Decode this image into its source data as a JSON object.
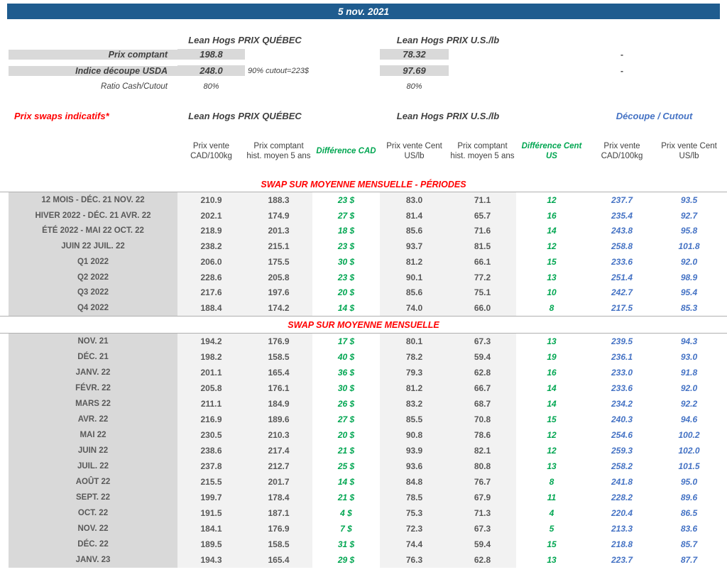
{
  "colors": {
    "bar_blue": "#1F5C8F",
    "red": "#FF0000",
    "green": "#00A651",
    "cutout_blue": "#4472C4",
    "label_bg": "#D9D9D9",
    "value_bg": "#F2F2F2"
  },
  "date_bar": {
    "date": "5 nov. 2021"
  },
  "top": {
    "quebec_header": "Lean Hogs PRIX QUÉBEC",
    "us_header": "Lean Hogs PRIX U.S./lb",
    "rows": [
      {
        "label": "Prix comptant",
        "qc": "198.8",
        "note": "",
        "us": "78.32",
        "cutout": "-"
      },
      {
        "label": "Indice découpe USDA",
        "qc": "248.0",
        "note": "90% cutout=223$",
        "us": "97.69",
        "cutout": "-"
      },
      {
        "label": "Ratio Cash/Cutout",
        "qc": "80%",
        "note": "",
        "us": "80%",
        "cutout": ""
      }
    ]
  },
  "swaps_header": {
    "title": "Prix swaps indicatifs*",
    "quebec_header": "Lean Hogs PRIX QUÉBEC",
    "us_header": "Lean Hogs PRIX U.S./lb",
    "cutout_header": "Découpe / Cutout",
    "columns": [
      "Prix vente CAD/100kg",
      "Prix comptant hist. moyen 5 ans",
      "Différence CAD",
      "Prix vente Cent US/lb",
      "Prix comptant hist. moyen 5 ans",
      "Différence Cent US",
      "Prix vente CAD/100kg",
      "Prix vente Cent US/lb"
    ]
  },
  "sections": [
    {
      "title": "SWAP SUR MOYENNE MENSUELLE - PÉRIODES",
      "rows": [
        [
          "12 MOIS - DÉC. 21 NOV. 22",
          "210.9",
          "188.3",
          "23 $",
          "83.0",
          "71.1",
          "12",
          "237.7",
          "93.5"
        ],
        [
          "HIVER 2022 - DÉC. 21 AVR. 22",
          "202.1",
          "174.9",
          "27 $",
          "81.4",
          "65.7",
          "16",
          "235.4",
          "92.7"
        ],
        [
          "ÉTÉ 2022 - MAI 22 OCT. 22",
          "218.9",
          "201.3",
          "18 $",
          "85.6",
          "71.6",
          "14",
          "243.8",
          "95.8"
        ],
        [
          "JUIN 22 JUIL. 22",
          "238.2",
          "215.1",
          "23 $",
          "93.7",
          "81.5",
          "12",
          "258.8",
          "101.8"
        ],
        [
          "Q1 2022",
          "206.0",
          "175.5",
          "30 $",
          "81.2",
          "66.1",
          "15",
          "233.6",
          "92.0"
        ],
        [
          "Q2 2022",
          "228.6",
          "205.8",
          "23 $",
          "90.1",
          "77.2",
          "13",
          "251.4",
          "98.9"
        ],
        [
          "Q3 2022",
          "217.6",
          "197.6",
          "20 $",
          "85.6",
          "75.1",
          "10",
          "242.7",
          "95.4"
        ],
        [
          "Q4 2022",
          "188.4",
          "174.2",
          "14 $",
          "74.0",
          "66.0",
          "8",
          "217.5",
          "85.3"
        ]
      ]
    },
    {
      "title": "SWAP SUR MOYENNE MENSUELLE",
      "rows": [
        [
          "NOV. 21",
          "194.2",
          "176.9",
          "17 $",
          "80.1",
          "67.3",
          "13",
          "239.5",
          "94.3"
        ],
        [
          "DÉC. 21",
          "198.2",
          "158.5",
          "40 $",
          "78.2",
          "59.4",
          "19",
          "236.1",
          "93.0"
        ],
        [
          "JANV. 22",
          "201.1",
          "165.4",
          "36 $",
          "79.3",
          "62.8",
          "16",
          "233.0",
          "91.8"
        ],
        [
          "FÉVR. 22",
          "205.8",
          "176.1",
          "30 $",
          "81.2",
          "66.7",
          "14",
          "233.6",
          "92.0"
        ],
        [
          "MARS 22",
          "211.1",
          "184.9",
          "26 $",
          "83.2",
          "68.7",
          "14",
          "234.2",
          "92.2"
        ],
        [
          "AVR. 22",
          "216.9",
          "189.6",
          "27 $",
          "85.5",
          "70.8",
          "15",
          "240.3",
          "94.6"
        ],
        [
          "MAI 22",
          "230.5",
          "210.3",
          "20 $",
          "90.8",
          "78.6",
          "12",
          "254.6",
          "100.2"
        ],
        [
          "JUIN 22",
          "238.6",
          "217.4",
          "21 $",
          "93.9",
          "82.1",
          "12",
          "259.3",
          "102.0"
        ],
        [
          "JUIL. 22",
          "237.8",
          "212.7",
          "25 $",
          "93.6",
          "80.8",
          "13",
          "258.2",
          "101.5"
        ],
        [
          "AOÛT 22",
          "215.5",
          "201.7",
          "14 $",
          "84.8",
          "76.7",
          "8",
          "241.8",
          "95.0"
        ],
        [
          "SEPT. 22",
          "199.7",
          "178.4",
          "21 $",
          "78.5",
          "67.9",
          "11",
          "228.2",
          "89.6"
        ],
        [
          "OCT. 22",
          "191.5",
          "187.1",
          "4 $",
          "75.3",
          "71.3",
          "4",
          "220.4",
          "86.5"
        ],
        [
          "NOV. 22",
          "184.1",
          "176.9",
          "7 $",
          "72.3",
          "67.3",
          "5",
          "213.3",
          "83.6"
        ],
        [
          "DÉC. 22",
          "189.5",
          "158.5",
          "31 $",
          "74.4",
          "59.4",
          "15",
          "218.8",
          "85.7"
        ],
        [
          "JANV. 23",
          "194.3",
          "165.4",
          "29 $",
          "76.3",
          "62.8",
          "13",
          "223.7",
          "87.7"
        ]
      ]
    }
  ]
}
